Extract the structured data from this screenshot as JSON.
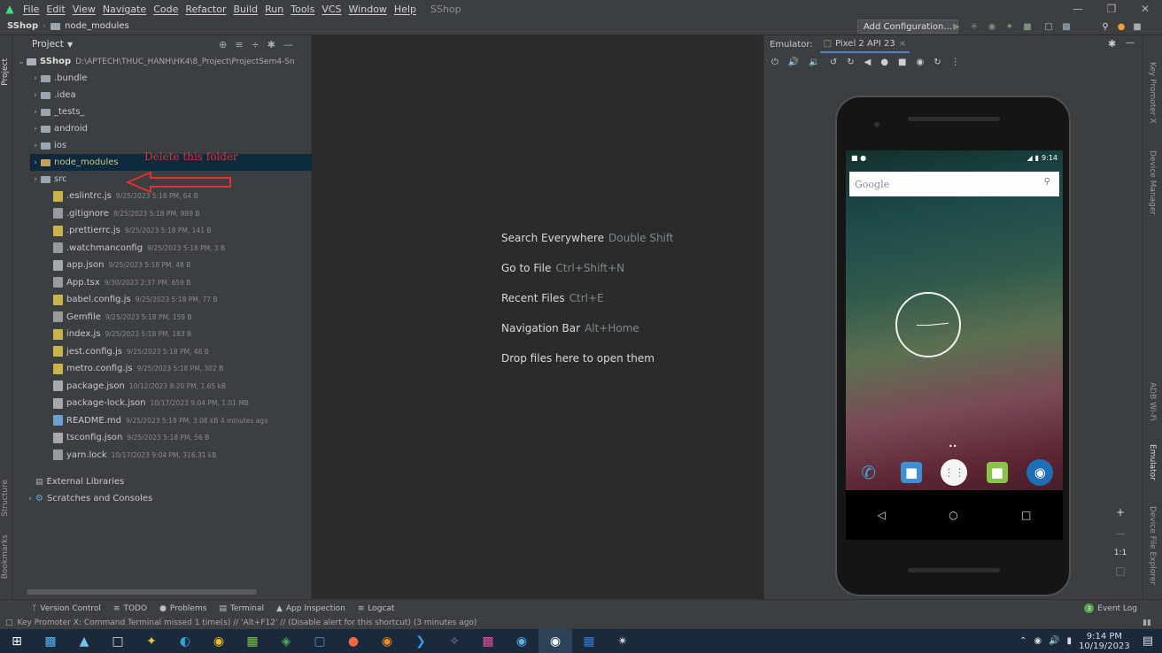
{
  "menubar": {
    "items": [
      "File",
      "Edit",
      "View",
      "Navigate",
      "Code",
      "Refactor",
      "Build",
      "Run",
      "Tools",
      "VCS",
      "Window",
      "Help"
    ],
    "project_name": "SShop"
  },
  "navbar": {
    "crumb_project": "SShop",
    "crumb_folder": "node_modules",
    "add_configuration": "Add Configuration..."
  },
  "left_strip": {
    "project": "Project",
    "structure": "Structure",
    "bookmarks": "Bookmarks"
  },
  "project_panel": {
    "title": "Project",
    "root_name": "SShop",
    "root_path": "D:\\APTECH\\THUC_HANH\\HK4\\8_Project\\ProjectSem4-Sn",
    "folders": [
      ".bundle",
      ".idea",
      "_tests_",
      "android",
      "ios",
      "node_modules",
      "src"
    ],
    "files": [
      {
        "name": ".eslintrc.js",
        "meta": "9/25/2023 5:18 PM, 64 B",
        "kind": "js"
      },
      {
        "name": ".gitignore",
        "meta": "9/25/2023 5:18 PM, 989 B",
        "kind": "txt"
      },
      {
        "name": ".prettierrc.js",
        "meta": "9/25/2023 5:18 PM, 141 B",
        "kind": "js"
      },
      {
        "name": ".watchmanconfig",
        "meta": "9/25/2023 5:18 PM, 3 B",
        "kind": "txt"
      },
      {
        "name": "app.json",
        "meta": "9/25/2023 5:18 PM, 48 B",
        "kind": "json"
      },
      {
        "name": "App.tsx",
        "meta": "9/30/2023 2:37 PM, 659 B",
        "kind": "txt"
      },
      {
        "name": "babel.config.js",
        "meta": "9/25/2023 5:18 PM, 77 B",
        "kind": "js"
      },
      {
        "name": "Gemfile",
        "meta": "9/25/2023 5:18 PM, 159 B",
        "kind": "txt"
      },
      {
        "name": "index.js",
        "meta": "9/25/2023 5:18 PM, 183 B",
        "kind": "js"
      },
      {
        "name": "jest.config.js",
        "meta": "9/25/2023 5:18 PM, 48 B",
        "kind": "js"
      },
      {
        "name": "metro.config.js",
        "meta": "9/25/2023 5:18 PM, 302 B",
        "kind": "js"
      },
      {
        "name": "package.json",
        "meta": "10/12/2023 8:20 PM, 1.65 kB",
        "kind": "json"
      },
      {
        "name": "package-lock.json",
        "meta": "10/17/2023 9:04 PM, 1.01 MB",
        "kind": "json"
      },
      {
        "name": "README.md",
        "meta": "9/25/2023 5:18 PM, 3.08 kB 4 minutes ago",
        "kind": "md"
      },
      {
        "name": "tsconfig.json",
        "meta": "9/25/2023 5:18 PM, 56 B",
        "kind": "json"
      },
      {
        "name": "yarn.lock",
        "meta": "10/17/2023 9:04 PM, 316.31 kB",
        "kind": "txt"
      }
    ],
    "external_libraries": "External Libraries",
    "scratches": "Scratches and Consoles"
  },
  "annotation": {
    "text": "Delete this folder",
    "color": "#e03030"
  },
  "editor_hints": [
    {
      "label": "Search Everywhere",
      "key": "Double Shift"
    },
    {
      "label": "Go to File",
      "key": "Ctrl+Shift+N"
    },
    {
      "label": "Recent Files",
      "key": "Ctrl+E"
    },
    {
      "label": "Navigation Bar",
      "key": "Alt+Home"
    },
    {
      "label": "Drop files here to open them",
      "key": ""
    }
  ],
  "emulator": {
    "label": "Emulator:",
    "device_tab": "Pixel 2 API 23",
    "status_time": "9:14",
    "search_placeholder": "Google",
    "zoom_ratio": "1:1"
  },
  "right_strip": {
    "key_promoter": "Key Promoter X",
    "device_manager": "Device Manager",
    "adb_wifi": "ADB Wi-Fi",
    "emulator": "Emulator",
    "device_file_explorer": "Device File Explorer"
  },
  "statusbar": {
    "tools": [
      "Version Control",
      "TODO",
      "Problems",
      "Terminal",
      "App Inspection",
      "Logcat"
    ],
    "event_log": "Event Log",
    "event_count": "3",
    "message": "Key Promoter X: Command Terminal missed 1 time(s) // 'Alt+F12' // (Disable alert for this shortcut) (3 minutes ago)"
  },
  "taskbar": {
    "time": "9:14 PM",
    "date": "10/19/2023"
  }
}
